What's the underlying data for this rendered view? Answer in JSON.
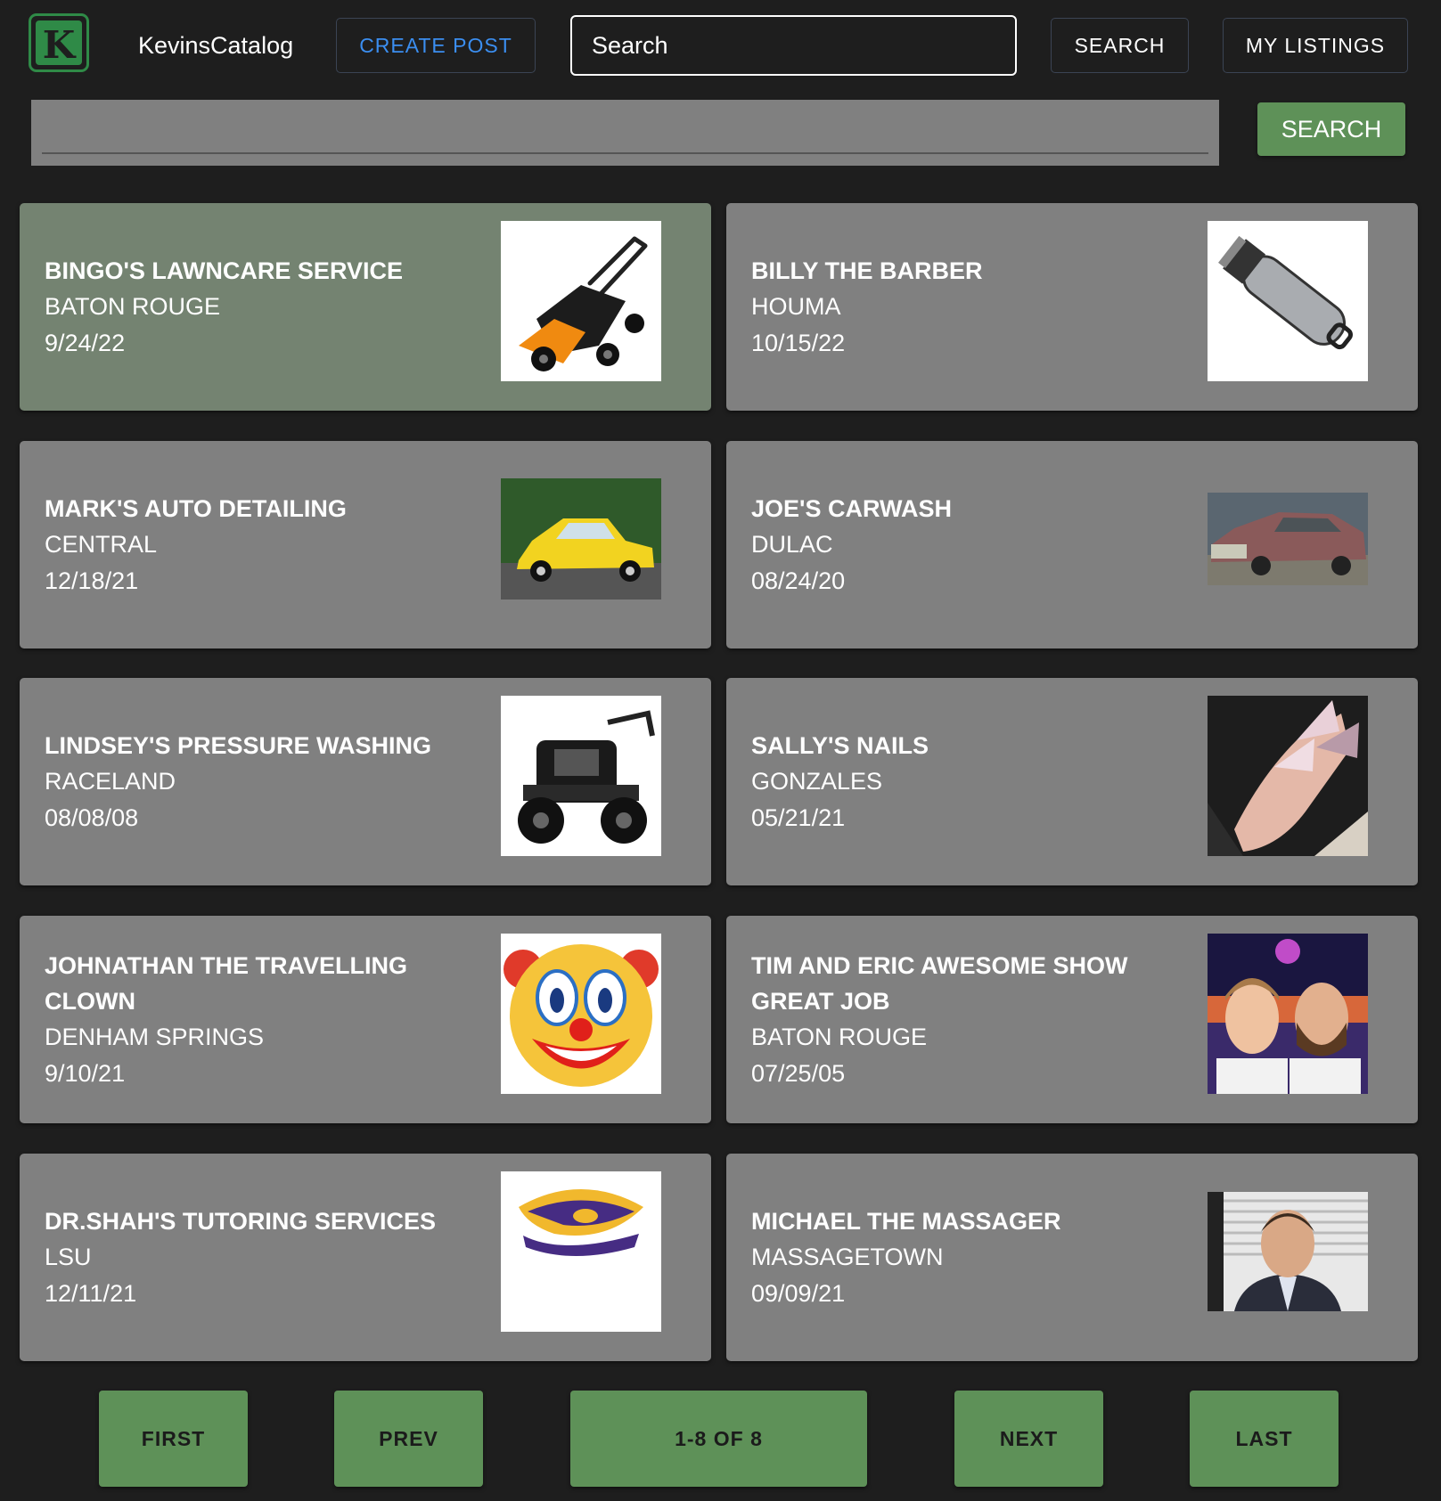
{
  "header": {
    "brand": "KevinsCatalog",
    "create_post_label": "CREATE POST",
    "search_placeholder": "Search",
    "search_button_label": "SEARCH",
    "my_listings_label": "MY LISTINGS"
  },
  "filter": {
    "value": "",
    "search_button_label": "SEARCH"
  },
  "listings": [
    {
      "title": "BINGO'S LAWNCARE SERVICE",
      "location": "BATON ROUGE",
      "date": "9/24/22",
      "image": "lawn-mower-image"
    },
    {
      "title": "BILLY THE BARBER",
      "location": "HOUMA",
      "date": "10/15/22",
      "image": "hair-clipper-image"
    },
    {
      "title": "MARK'S AUTO DETAILING",
      "location": "CENTRAL",
      "date": "12/18/21",
      "image": "yellow-classic-car-image"
    },
    {
      "title": "JOE'S CARWASH",
      "location": "DULAC",
      "date": "08/24/20",
      "image": "old-sedan-image"
    },
    {
      "title": "LINDSEY'S PRESSURE WASHING",
      "location": "RACELAND",
      "date": "08/08/08",
      "image": "pressure-washer-image"
    },
    {
      "title": "SALLY'S NAILS",
      "location": "GONZALES",
      "date": "05/21/21",
      "image": "manicured-nails-image"
    },
    {
      "title": "JOHNATHAN THE TRAVELLING CLOWN",
      "location": "DENHAM SPRINGS",
      "date": "9/10/21",
      "image": "clown-face-image"
    },
    {
      "title": "TIM AND ERIC AWESOME SHOW GREAT JOB",
      "location": "BATON ROUGE",
      "date": "07/25/05",
      "image": "tim-and-eric-image"
    },
    {
      "title": "DR.SHAH'S TUTORING SERVICES",
      "location": "LSU",
      "date": "12/11/21",
      "image": "lsu-logo-image"
    },
    {
      "title": "MICHAEL THE MASSAGER",
      "location": "MASSAGETOWN",
      "date": "09/09/21",
      "image": "office-man-portrait-image"
    }
  ],
  "pagination": {
    "first": "FIRST",
    "prev": "PREV",
    "range": "1-8 OF 8",
    "next": "NEXT",
    "last": "LAST"
  },
  "colors": {
    "background": "#1e1e1e",
    "card": "#808080",
    "card_highlight": "#748371",
    "green_button": "#5e9158",
    "link_blue": "#3b8ef0",
    "logo_green": "#2f8a47"
  }
}
